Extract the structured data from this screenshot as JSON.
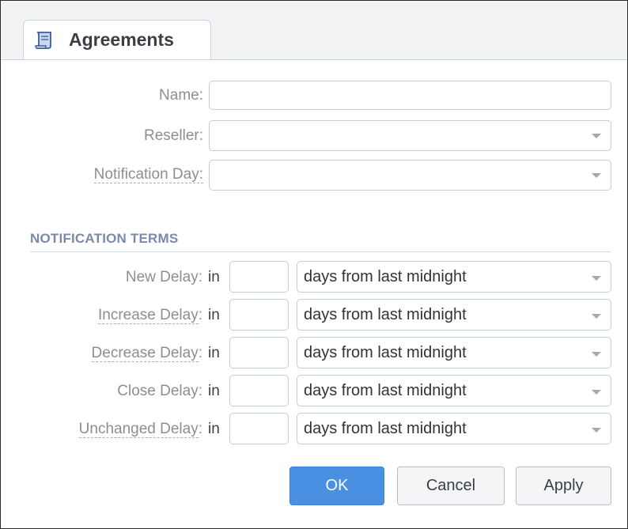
{
  "tab": {
    "title": "Agreements",
    "icon": "scroll-icon"
  },
  "form": {
    "name_label": "Name:",
    "reseller_label": "Reseller:",
    "notification_day_label": "Notification Day:",
    "name_value": "",
    "reseller_value": "",
    "notification_day_value": ""
  },
  "section": {
    "title": "NOTIFICATION TERMS"
  },
  "terms": [
    {
      "label": "New Delay",
      "colon": ":",
      "in": "in",
      "value": "",
      "unit": "days from last midnight"
    },
    {
      "label": "Increase Delay",
      "colon": ":",
      "in": "in",
      "value": "",
      "unit": "days from last midnight"
    },
    {
      "label": "Decrease Delay",
      "colon": ":",
      "in": "in",
      "value": "",
      "unit": "days from last midnight"
    },
    {
      "label": "Close Delay",
      "colon": ":",
      "in": "in",
      "value": "",
      "unit": "days from last midnight"
    },
    {
      "label": "Unchanged Delay",
      "colon": ":",
      "in": "in",
      "value": "",
      "unit": "days from last midnight"
    }
  ],
  "buttons": {
    "ok": "OK",
    "cancel": "Cancel",
    "apply": "Apply"
  },
  "colors": {
    "primary": "#4a90e2",
    "section": "#7a8aa8",
    "label": "#8a8f95"
  }
}
